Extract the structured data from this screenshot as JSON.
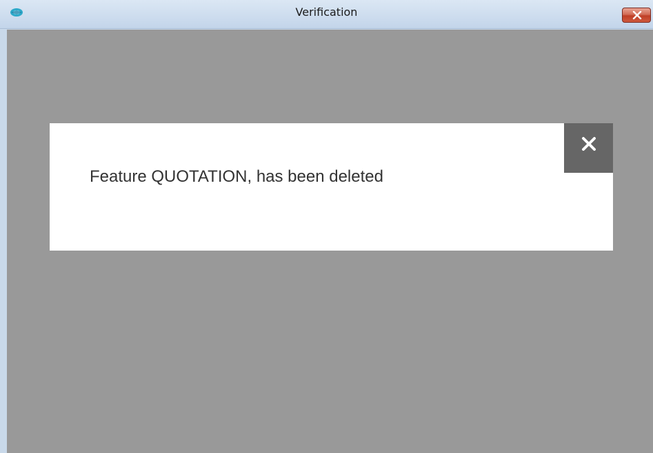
{
  "window": {
    "title": "Verification",
    "app_icon": "app-logo-icon",
    "close_icon": "close-icon"
  },
  "dialog": {
    "message": "Feature QUOTATION, has been deleted",
    "close_icon": "close-icon"
  },
  "colors": {
    "titlebar": "#c9d9ea",
    "overlay": "#999999",
    "dialog_background": "#ffffff",
    "dialog_close_background": "#666666",
    "window_close": "#c7482e",
    "message_text": "#333333"
  }
}
